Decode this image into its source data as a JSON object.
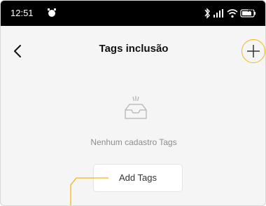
{
  "status_bar": {
    "time": "12:51",
    "battery": "70",
    "icons": [
      "alarm-icon",
      "bluetooth-icon",
      "signal-icon",
      "wifi-icon",
      "battery-icon"
    ]
  },
  "header": {
    "title": "Tags inclusão",
    "back_icon": "back-arrow-icon",
    "add_icon": "plus-icon"
  },
  "empty_state": {
    "icon": "empty-inbox-icon",
    "message": "Nenhum cadastro Tags"
  },
  "actions": {
    "add_label": "Add Tags"
  },
  "colors": {
    "highlight": "#f3b515",
    "background": "#f5f5f5",
    "text_muted": "#8d8d8d"
  }
}
